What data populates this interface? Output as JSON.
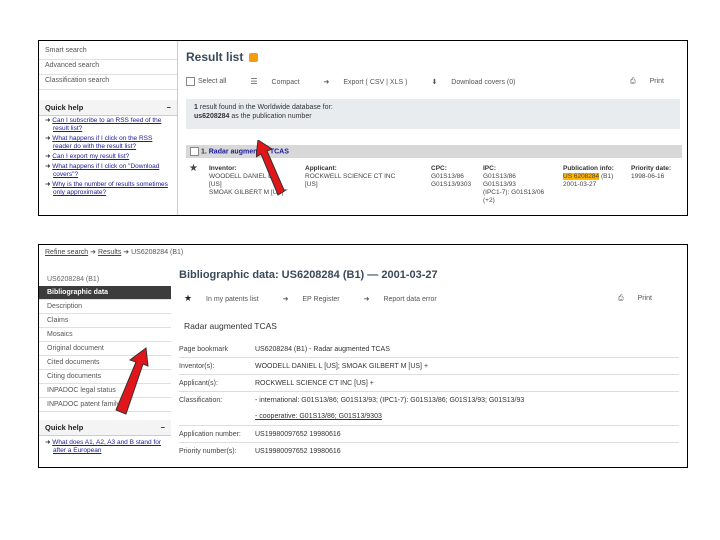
{
  "top": {
    "sidebar": [
      "Smart search",
      "Advanced search",
      "Classification search"
    ],
    "quick_help": {
      "title": "Quick help",
      "collapse": "−",
      "items": [
        "Can I subscribe to an RSS feed of the result list?",
        "What happens if I click on the RSS reader do with the result list?",
        "Can I export my result list?",
        "What happens if I click on \"Download covers\"?",
        "Why is the number of results sometimes only approximate?"
      ]
    },
    "title": "Result list",
    "toolbar": {
      "select_all": "Select all",
      "compact": "Compact",
      "export": "Export ( CSV | XLS )",
      "download_covers": "Download covers (0)",
      "print": "Print"
    },
    "info": {
      "line1_count": "1",
      "line1_rest": "result found in the Worldwide database for:",
      "query": "us6208284",
      "line2_rest": "as the publication number"
    },
    "result": {
      "number": "1.",
      "title": "Radar augmented TCAS",
      "inventor_h": "Inventor:",
      "inventor": [
        "WOODELL DANIEL L",
        "[US]",
        "SMOAK GILBERT M [US]"
      ],
      "applicant_h": "Applicant:",
      "applicant": [
        "ROCKWELL SCIENCE CT INC",
        "[US]"
      ],
      "cpc_h": "CPC:",
      "cpc": [
        "G01S13/86",
        "G01S13/9303"
      ],
      "ipc_h": "IPC:",
      "ipc": [
        "G01S13/86",
        "G01S13/93",
        "(IPC1-7): G01S13/06",
        "(+2)"
      ],
      "pub_h": "Publication info:",
      "pub_num": "US 6208284",
      "pub_kind": "(B1)",
      "pub_date": "2001-03-27",
      "prio_h": "Priority date:",
      "prio": "1998-06-16"
    }
  },
  "bottom": {
    "breadcrumb": [
      "Refine search",
      "Results",
      "US6208284 (B1)"
    ],
    "sidebar_header": "US6208284 (B1)",
    "nav": [
      "Bibliographic data",
      "Description",
      "Claims",
      "Mosaics",
      "Original document",
      "Cited documents",
      "Citing documents",
      "INPADOC legal status",
      "INPADOC patent family"
    ],
    "quick_help": {
      "title": "Quick help",
      "collapse": "−",
      "item": "What does A1, A2, A3 and B stand for after a European"
    },
    "title": "Bibliographic data: US6208284 (B1) — 2001-03-27",
    "actions": {
      "my_patents": "In my patents list",
      "ep_register": "EP Register",
      "report_error": "Report data error",
      "print": "Print"
    },
    "doc_title": "Radar augmented TCAS",
    "rows": [
      {
        "label": "Page bookmark",
        "value": "US6208284 (B1) - Radar augmented TCAS"
      },
      {
        "label": "Inventor(s):",
        "value": "WOODELL DANIEL L [US]; SMOAK GILBERT M [US] +"
      },
      {
        "label": "Applicant(s):",
        "value": "ROCKWELL SCIENCE CT INC [US] +"
      },
      {
        "label": "Classification:",
        "value": "- international: G01S13/86; G01S13/93; (IPC1-7): G01S13/86; G01S13/93; G01S13/93"
      },
      {
        "label": "",
        "value": "- cooperative: G01S13/86; G01S13/9303"
      },
      {
        "label": "Application number:",
        "value": "US19980097652 19980616"
      },
      {
        "label": "Priority number(s):",
        "value": "US19980097652 19980616"
      }
    ]
  },
  "colors": {
    "highlight": "#ffb400",
    "arrow": "#e0161b",
    "nav_active": "#3c3c3c"
  }
}
